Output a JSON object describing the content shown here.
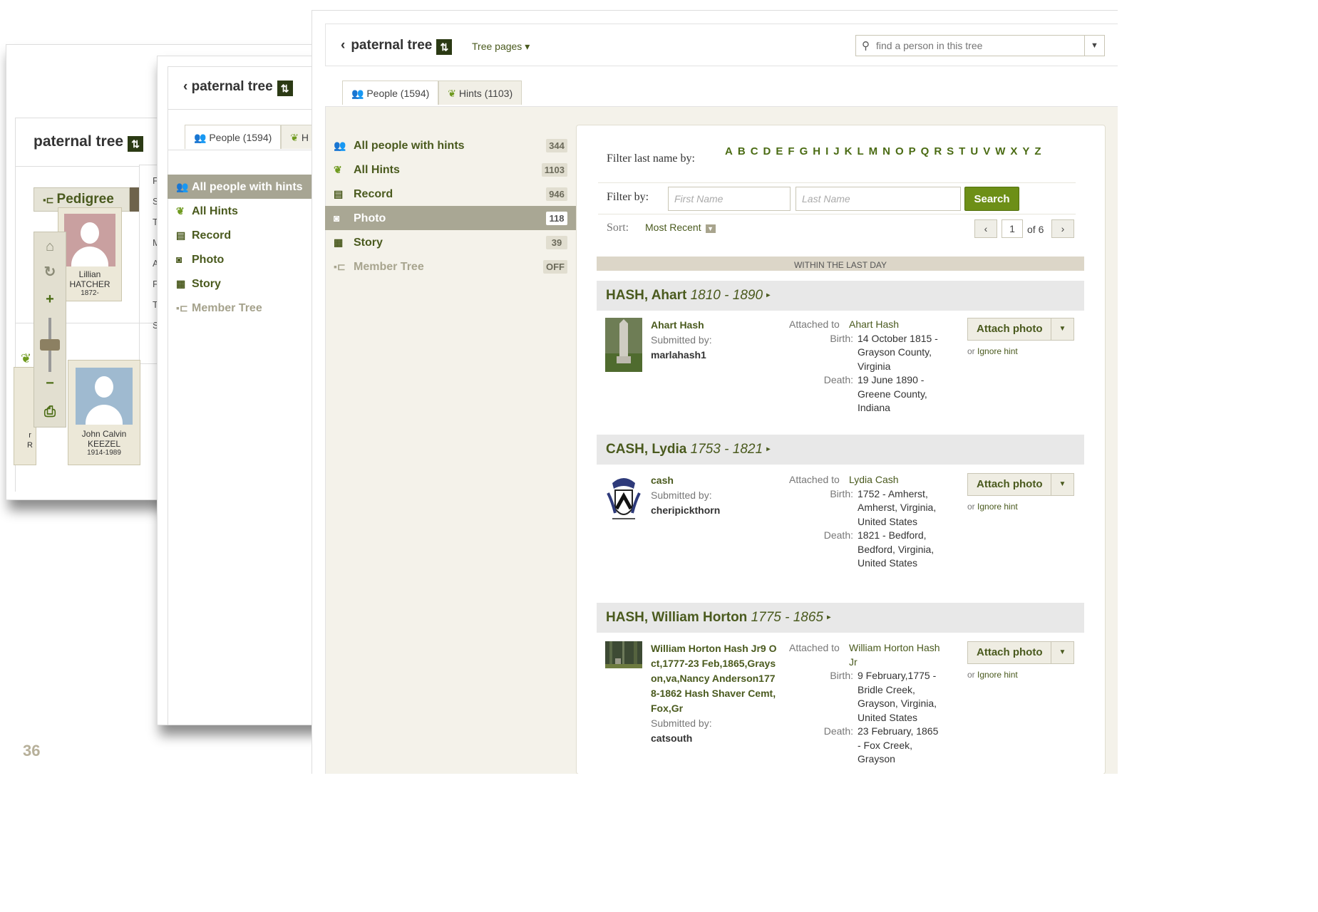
{
  "page_number": "36",
  "panel1": {
    "title": "paternal tree",
    "pedigree_label": "Pedigree",
    "card1": {
      "first": "Lillian",
      "last": "HATCHER",
      "years": "1872-"
    },
    "card2": {
      "first": "John Calvin",
      "last": "KEEZEL",
      "years": "1914-1989"
    },
    "card3": {
      "line1": "r",
      "line2": "R"
    },
    "popup_letters": [
      "F",
      "S",
      "T",
      "M",
      "A",
      "F",
      "T",
      "S"
    ]
  },
  "panel2": {
    "title": "paternal tree",
    "tab_people": "People (1594)",
    "tab_hints_partial": "H",
    "sidebar": [
      {
        "label": "All people with hints"
      },
      {
        "label": "All Hints"
      },
      {
        "label": "Record"
      },
      {
        "label": "Photo"
      },
      {
        "label": "Story"
      },
      {
        "label": "Member Tree"
      }
    ]
  },
  "panel3": {
    "back_label": "paternal tree",
    "tree_pages": "Tree pages ▾",
    "search": {
      "placeholder": "find a person in this tree"
    },
    "tabs": {
      "people": "People (1594)",
      "hints": "Hints (1103)"
    },
    "sidebar": [
      {
        "label": "All people with hints",
        "count": "344"
      },
      {
        "label": "All Hints",
        "count": "1103"
      },
      {
        "label": "Record",
        "count": "946"
      },
      {
        "label": "Photo",
        "count": "118"
      },
      {
        "label": "Story",
        "count": "39"
      },
      {
        "label": "Member Tree",
        "count": "OFF"
      }
    ],
    "filter": {
      "last_name_label": "Filter last name by:",
      "letters": [
        "A",
        "B",
        "C",
        "D",
        "E",
        "F",
        "G",
        "H",
        "I",
        "J",
        "K",
        "L",
        "M",
        "N",
        "O",
        "P",
        "Q",
        "R",
        "S",
        "T",
        "U",
        "V",
        "W",
        "X",
        "Y",
        "Z"
      ],
      "by_label": "Filter by:",
      "first_name_placeholder": "First Name",
      "last_name_placeholder": "Last Name",
      "search_button": "Search",
      "sort_label": "Sort:",
      "sort_value": "Most Recent",
      "page": "1",
      "of_pages": "of 6"
    },
    "section_label": "WITHIN THE LAST DAY",
    "persons": [
      {
        "name": "HASH, Ahart",
        "years": "1810 - 1890",
        "hint_title": "Ahart Hash",
        "submitted_label": "Submitted by:",
        "submitter": "marlahash1",
        "attached_label": "Attached to",
        "attached_to": "Ahart Hash",
        "birth_label": "Birth:",
        "birth": "14 October 1815 - Grayson County, Virginia",
        "death_label": "Death:",
        "death": "19 June 1890 - Greene County, Indiana",
        "attach_label": "Attach photo",
        "ignore_prefix": "or",
        "ignore_link": "Ignore hint"
      },
      {
        "name": "CASH, Lydia",
        "years": "1753 - 1821",
        "hint_title": "cash",
        "submitted_label": "Submitted by:",
        "submitter": "cheripickthorn",
        "attached_label": "Attached to",
        "attached_to": "Lydia Cash",
        "birth_label": "Birth:",
        "birth": "1752 - Amherst, Amherst, Virginia, United States",
        "death_label": "Death:",
        "death": "1821 - Bedford, Bedford, Virginia, United States",
        "attach_label": "Attach photo",
        "ignore_prefix": "or",
        "ignore_link": "Ignore hint"
      },
      {
        "name": "HASH, William Horton",
        "years": "1775 - 1865",
        "hint_title": "William Horton Hash Jr9 Oct,1777-23 Feb,1865,Grayson,va,Nancy Anderson1778-1862 Hash Shaver Cemt,Fox,Gr",
        "submitted_label": "Submitted by:",
        "submitter": "catsouth",
        "attached_label": "Attached to",
        "attached_to": "William Horton Hash Jr",
        "birth_label": "Birth:",
        "birth": "9 February,1775 - Bridle Creek, Grayson, Virginia, United States",
        "death_label": "Death:",
        "death": "23 February, 1865 - Fox Creek, Grayson",
        "attach_label": "Attach photo",
        "ignore_prefix": "or",
        "ignore_link": "Ignore hint"
      }
    ]
  },
  "colors": {
    "brand_green": "#4a5a1e",
    "search_green": "#6d8f17",
    "active_sidebar": "#a9a794",
    "person_header_bg": "#e8e8e8"
  }
}
